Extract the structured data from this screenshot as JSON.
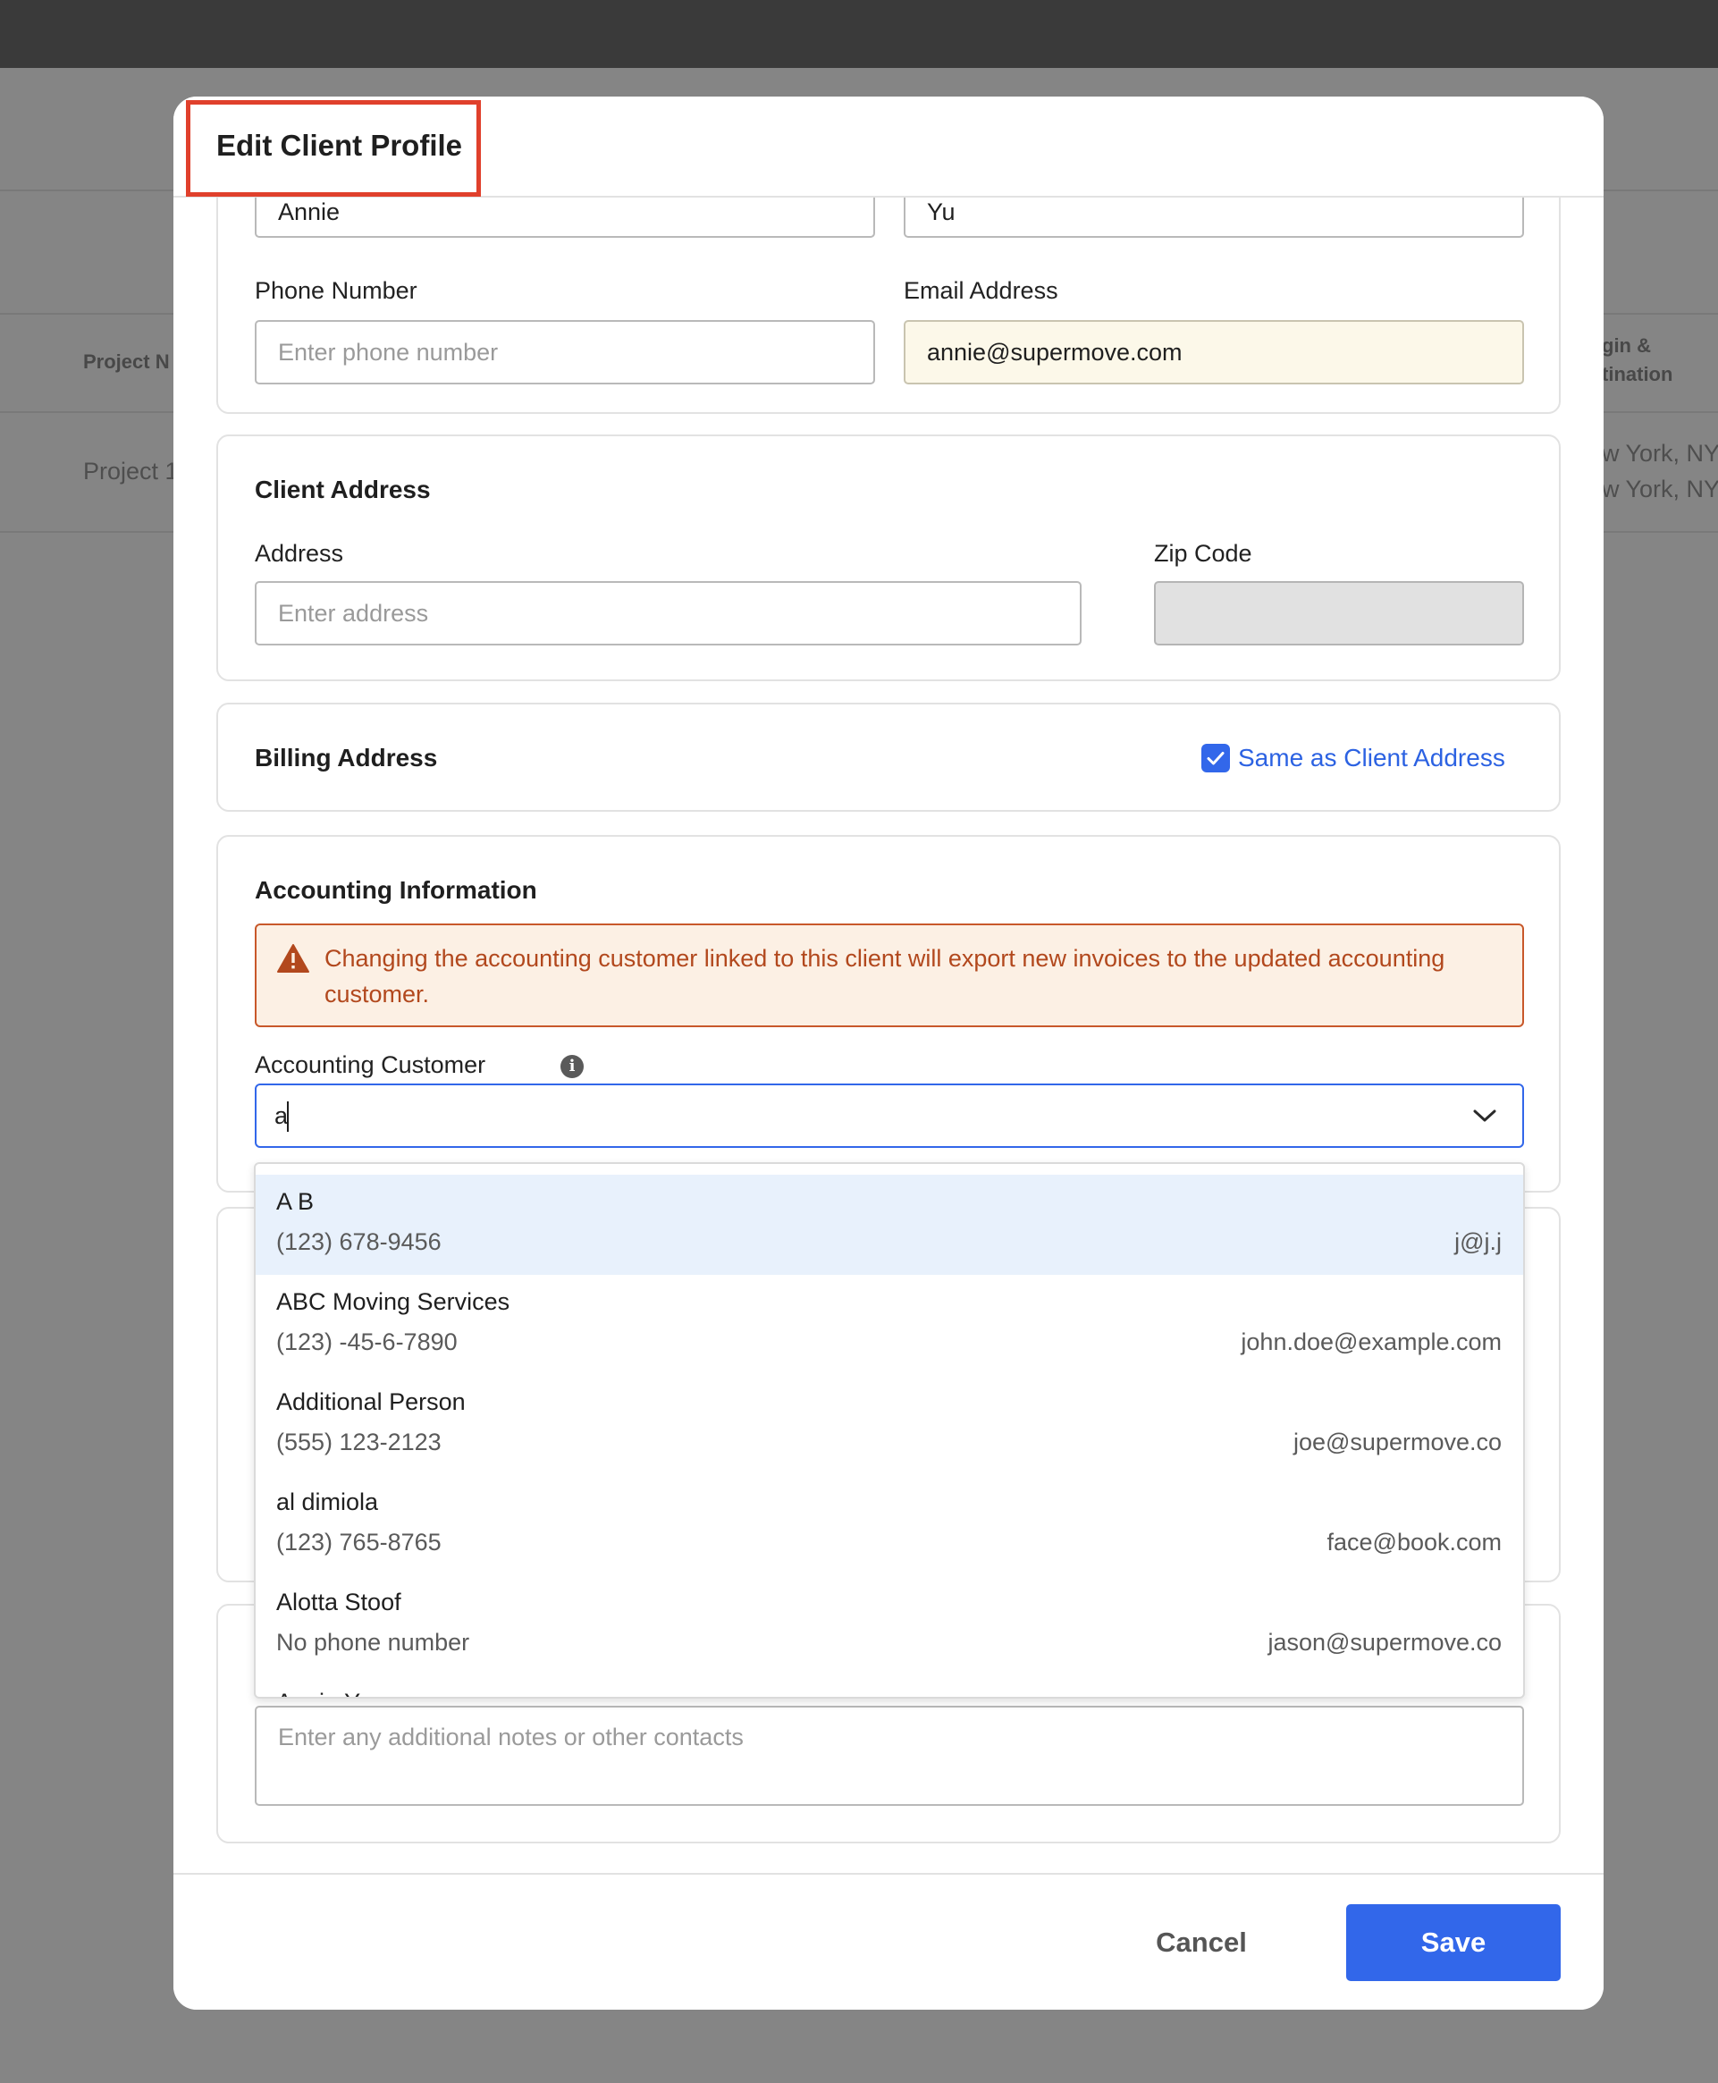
{
  "background": {
    "table_header_left": "Project N",
    "table_header_right_line1": "gin &",
    "table_header_right_line2": "tination",
    "row_left": "Project 1",
    "row_right_line1": "w York, NY",
    "row_right_line2": "w York, NY"
  },
  "modal": {
    "title": "Edit Client Profile"
  },
  "contact": {
    "first_name_value": "Annie",
    "last_name_value": "Yu",
    "phone_label": "Phone Number",
    "phone_placeholder": "Enter phone number",
    "email_label": "Email Address",
    "email_value": "annie@supermove.com"
  },
  "client_address": {
    "title": "Client Address",
    "address_label": "Address",
    "address_placeholder": "Enter address",
    "zip_label": "Zip Code"
  },
  "billing_address": {
    "title": "Billing Address",
    "same_as_label": "Same as Client Address",
    "same_as_checked": true
  },
  "accounting": {
    "title": "Accounting Information",
    "warning_text": "Changing the accounting customer linked to this client will export new invoices to the updated accounting customer.",
    "customer_label": "Accounting Customer",
    "customer_input_value": "a"
  },
  "dropdown_options": [
    {
      "name": "A B",
      "phone": "(123) 678-9456",
      "email": "j@j.j",
      "highlighted": true
    },
    {
      "name": "ABC Moving Services",
      "phone": "(123) -45-6-7890",
      "email": "john.doe@example.com",
      "highlighted": false
    },
    {
      "name": "Additional Person",
      "phone": "(555) 123-2123",
      "email": "joe@supermove.co",
      "highlighted": false
    },
    {
      "name": "al dimiola",
      "phone": "(123) 765-8765",
      "email": "face@book.com",
      "highlighted": false
    },
    {
      "name": "Alotta Stoof",
      "phone": "No phone number",
      "email": "jason@supermove.co",
      "highlighted": false
    },
    {
      "name": "Annie Yu",
      "phone": "",
      "email": "",
      "highlighted": false
    }
  ],
  "notes": {
    "placeholder": "Enter any additional notes or other contacts"
  },
  "footer": {
    "cancel_label": "Cancel",
    "save_label": "Save"
  },
  "colors": {
    "primary": "#3267ea",
    "highlight_border": "#e0402c",
    "warning_text": "#b2481d",
    "warning_bg": "#fcf0e4"
  }
}
